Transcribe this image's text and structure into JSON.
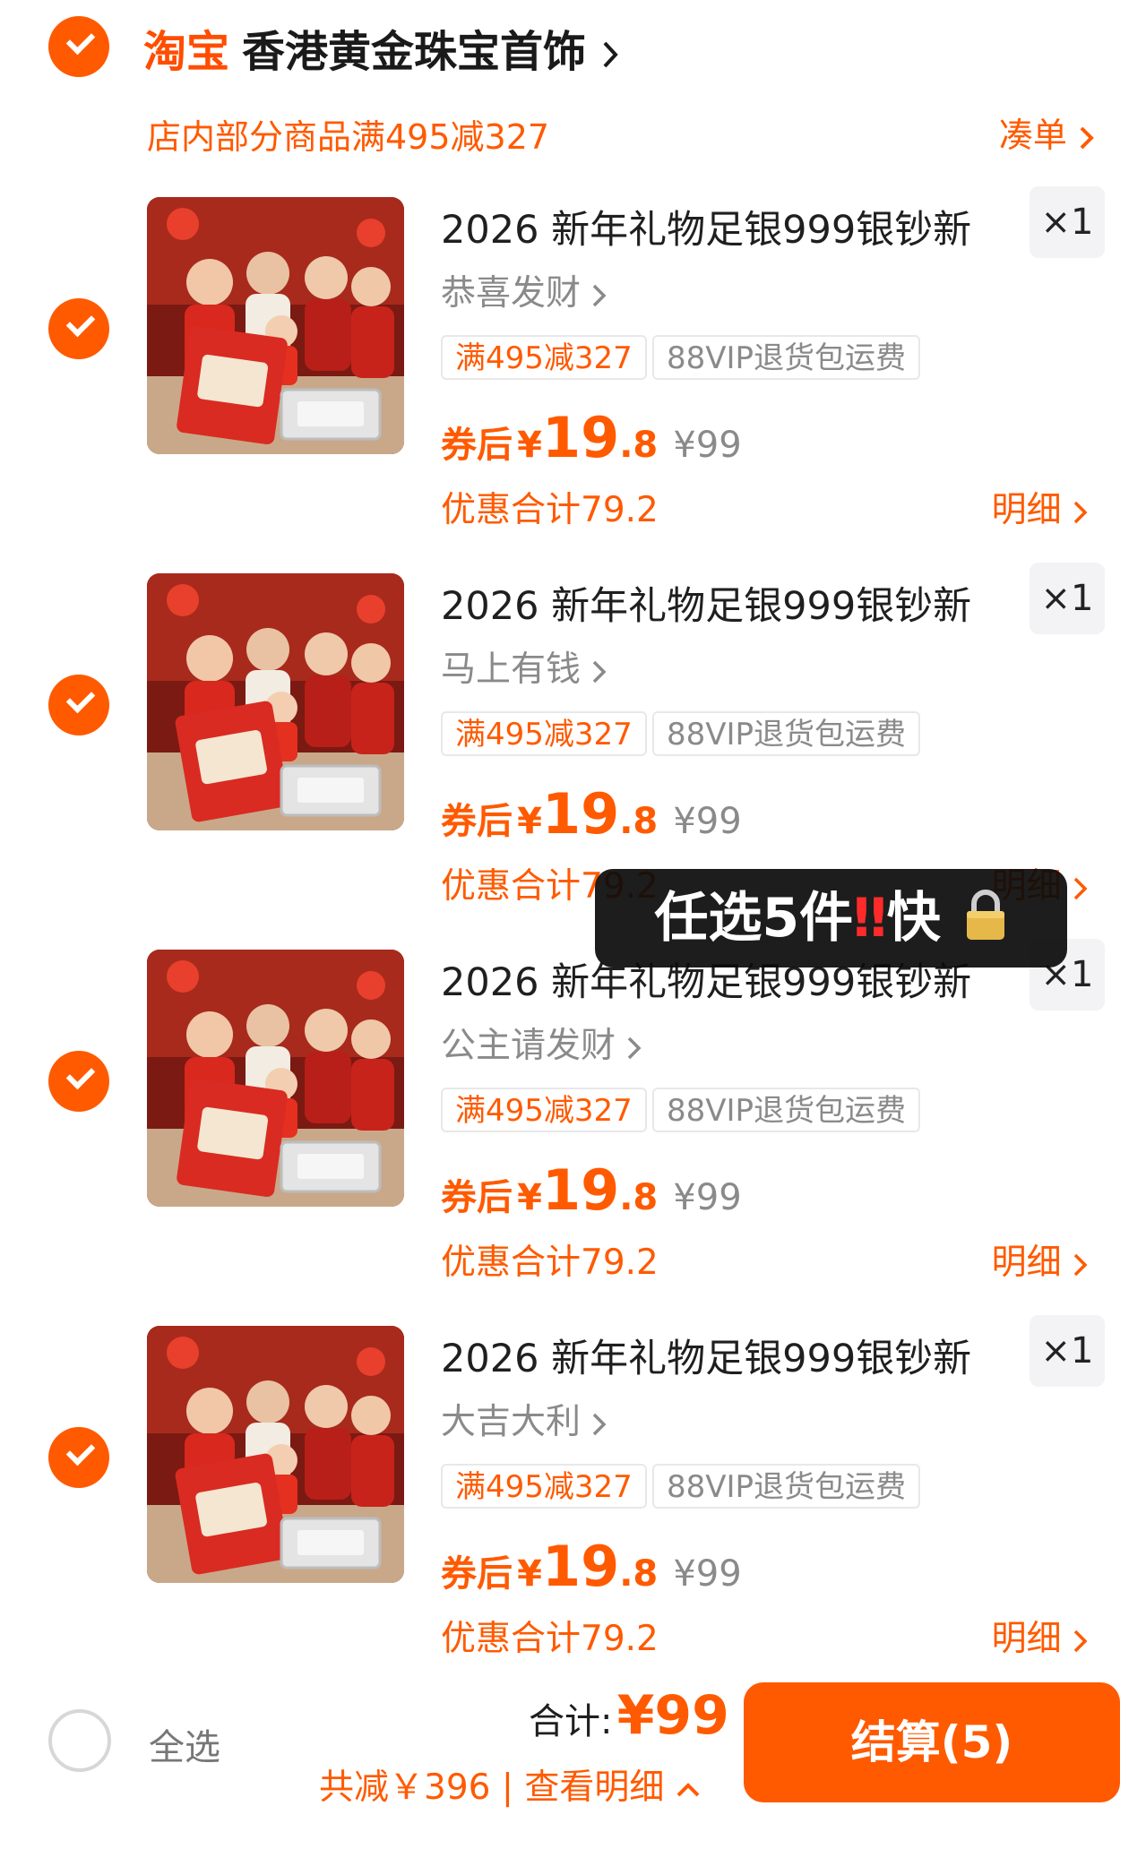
{
  "colors": {
    "accent": "#ff5a00",
    "overlay_bg": "#111111",
    "tag_border": "#e8e8e8"
  },
  "shop": {
    "brand": "淘宝",
    "name": "香港黄金珠宝首饰",
    "promo": "店内部分商品满495减327",
    "coudan": "凑单"
  },
  "items": [
    {
      "title": "2026 新年礼物足银999银钞新",
      "variant": "恭喜发财",
      "qty": "×1",
      "tag1": "满495减327",
      "tag2": "88VIP退货包运费",
      "price_label": "券后",
      "currency": "¥",
      "price_int": "19",
      "price_dec": ".8",
      "orig_price": "¥99",
      "discount": "优惠合计79.2",
      "detail": "明细",
      "image_icon": "red-envelope-family-photo"
    },
    {
      "title": "2026 新年礼物足银999银钞新",
      "variant": "马上有钱",
      "qty": "×1",
      "tag1": "满495减327",
      "tag2": "88VIP退货包运费",
      "price_label": "券后",
      "currency": "¥",
      "price_int": "19",
      "price_dec": ".8",
      "orig_price": "¥99",
      "discount": "优惠合计79.2",
      "detail": "明细",
      "image_icon": "red-envelope-family-photo"
    },
    {
      "title": "2026 新年礼物足银999银钞新",
      "variant": "公主请发财",
      "qty": "×1",
      "tag1": "满495减327",
      "tag2": "88VIP退货包运费",
      "price_label": "券后",
      "currency": "¥",
      "price_int": "19",
      "price_dec": ".8",
      "orig_price": "¥99",
      "discount": "优惠合计79.2",
      "detail": "明细",
      "image_icon": "red-envelope-family-photo"
    },
    {
      "title": "2026 新年礼物足银999银钞新",
      "variant": "大吉大利",
      "qty": "×1",
      "tag1": "满495减327",
      "tag2": "88VIP退货包运费",
      "price_label": "券后",
      "currency": "¥",
      "price_int": "19",
      "price_dec": ".8",
      "orig_price": "¥99",
      "discount": "优惠合计79.2",
      "detail": "明细",
      "image_icon": "red-envelope-family-photo"
    }
  ],
  "overlay": {
    "text_a": "任选5件",
    "bang": "‼",
    "text_b": "快",
    "icon": "lock-icon"
  },
  "footer": {
    "select_all": "全选",
    "total_label": "合计:",
    "total_value": "¥99",
    "saved": "共减￥396 | 查看明细",
    "checkout": "结算(5)"
  }
}
